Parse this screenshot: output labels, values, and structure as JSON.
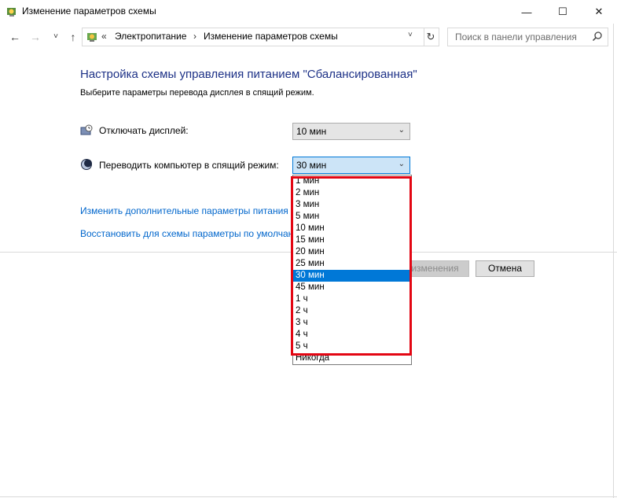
{
  "window": {
    "title": "Изменение параметров схемы",
    "icon": "power-options-icon",
    "minimize": "—",
    "maximize": "☐",
    "close": "✕"
  },
  "nav": {
    "back": "←",
    "forward": "→",
    "recent": "˅",
    "up": "↑",
    "address_icon": "control-panel-icon",
    "chevrons": "«",
    "crumbs": [
      "Электропитание",
      "Изменение параметров схемы"
    ],
    "crumb_separator": "›",
    "address_dropdown": "˅",
    "refresh": "↻",
    "search_placeholder": "Поиск в панели управления"
  },
  "content": {
    "heading": "Настройка схемы управления питанием \"Сбалансированная\"",
    "subheading": "Выберите параметры перевода дисплея в спящий режим.",
    "display_off": {
      "icon": "monitor-clock-icon",
      "label": "Отключать дисплей:",
      "value": "10 мин"
    },
    "sleep": {
      "icon": "moon-icon",
      "label": "Переводить компьютер в спящий режим:",
      "value": "30 мин"
    },
    "link_advanced": "Изменить дополнительные параметры питания",
    "link_restore": "Восстановить для схемы параметры по умолчанию",
    "save_button": "Сохранить изменения",
    "cancel_button": "Отмена"
  },
  "dropdown": {
    "options": [
      "1 мин",
      "2 мин",
      "3 мин",
      "5 мин",
      "10 мин",
      "15 мин",
      "20 мин",
      "25 мин",
      "30 мин",
      "45 мин",
      "1 ч",
      "2 ч",
      "3 ч",
      "4 ч",
      "5 ч",
      "Никогда"
    ],
    "selected": "30 мин",
    "highlight_color": "#e30613",
    "selection_color": "#0078d7"
  }
}
